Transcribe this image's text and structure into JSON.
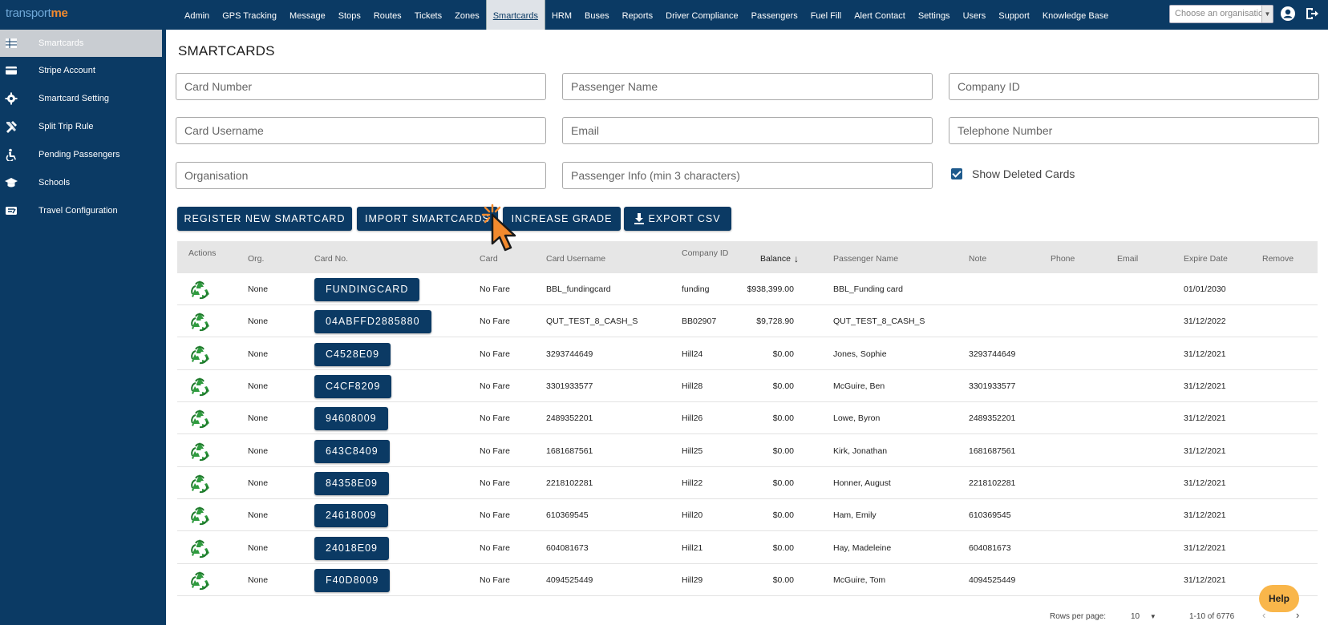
{
  "brand": {
    "part1": "transport",
    "part2": "me"
  },
  "nav": [
    "Admin",
    "GPS Tracking",
    "Message",
    "Stops",
    "Routes",
    "Tickets",
    "Zones",
    "Smartcards",
    "HRM",
    "Buses",
    "Reports",
    "Driver Compliance",
    "Passengers",
    "Fuel Fill",
    "Alert Contact",
    "Settings",
    "Users",
    "Support",
    "Knowledge Base"
  ],
  "nav_active": "Smartcards",
  "org_select": {
    "placeholder": "Choose an organisation"
  },
  "sidebar": [
    {
      "label": "Smartcards",
      "icon": "table-icon",
      "active": true
    },
    {
      "label": "Stripe Account",
      "icon": "credit-card-icon"
    },
    {
      "label": "Smartcard Setting",
      "icon": "gear-icon"
    },
    {
      "label": "Split Trip Rule",
      "icon": "tools-icon"
    },
    {
      "label": "Pending Passengers",
      "icon": "accessible-icon"
    },
    {
      "label": "Schools",
      "icon": "graduation-cap-icon"
    },
    {
      "label": "Travel Configuration",
      "icon": "config-card-icon"
    }
  ],
  "page_title": "SMARTCARDS",
  "filters": {
    "card_number": "Card Number",
    "passenger_name": "Passenger Name",
    "company_id": "Company ID",
    "card_username": "Card Username",
    "email": "Email",
    "telephone": "Telephone Number",
    "organisation": "Organisation",
    "passenger_info": "Passenger Info (min 3 characters)",
    "show_deleted": "Show Deleted Cards"
  },
  "buttons": {
    "register": "REGISTER NEW SMARTCARD",
    "import": "IMPORT SMARTCARDS",
    "increase": "INCREASE GRADE",
    "export": "EXPORT CSV"
  },
  "columns": [
    "Actions",
    "Org.",
    "Card No.",
    "Card",
    "Card Username",
    "Company ID",
    "Balance",
    "Passenger Name",
    "Note",
    "Phone",
    "Email",
    "Expire Date",
    "Remove"
  ],
  "rows": [
    {
      "org": "None",
      "card_no": "FUNDINGCARD",
      "fare": "No Fare",
      "username": "BBL_fundingcard",
      "company": "funding",
      "balance": "$938,399.00",
      "name": "BBL_Funding card",
      "note": "",
      "expire": "01/01/2030"
    },
    {
      "org": "None",
      "card_no": "04ABFFD2885880",
      "fare": "No Fare",
      "username": "QUT_TEST_8_CASH_S",
      "company": "BB02907",
      "balance": "$9,728.90",
      "name": "QUT_TEST_8_CASH_S",
      "note": "",
      "expire": "31/12/2022"
    },
    {
      "org": "None",
      "card_no": "C4528E09",
      "fare": "No Fare",
      "username": "3293744649",
      "company": "Hill24",
      "balance": "$0.00",
      "name": "Jones, Sophie",
      "note": "3293744649",
      "expire": "31/12/2021"
    },
    {
      "org": "None",
      "card_no": "C4CF8209",
      "fare": "No Fare",
      "username": "3301933577",
      "company": "Hill28",
      "balance": "$0.00",
      "name": "McGuire, Ben",
      "note": "3301933577",
      "expire": "31/12/2021"
    },
    {
      "org": "None",
      "card_no": "94608009",
      "fare": "No Fare",
      "username": "2489352201",
      "company": "Hill26",
      "balance": "$0.00",
      "name": "Lowe, Byron",
      "note": "2489352201",
      "expire": "31/12/2021"
    },
    {
      "org": "None",
      "card_no": "643C8409",
      "fare": "No Fare",
      "username": "1681687561",
      "company": "Hill25",
      "balance": "$0.00",
      "name": "Kirk, Jonathan",
      "note": "1681687561",
      "expire": "31/12/2021"
    },
    {
      "org": "None",
      "card_no": "84358E09",
      "fare": "No Fare",
      "username": "2218102281",
      "company": "Hill22",
      "balance": "$0.00",
      "name": "Honner, August",
      "note": "2218102281",
      "expire": "31/12/2021"
    },
    {
      "org": "None",
      "card_no": "24618009",
      "fare": "No Fare",
      "username": "610369545",
      "company": "Hill20",
      "balance": "$0.00",
      "name": "Ham, Emily",
      "note": "610369545",
      "expire": "31/12/2021"
    },
    {
      "org": "None",
      "card_no": "24018E09",
      "fare": "No Fare",
      "username": "604081673",
      "company": "Hill21",
      "balance": "$0.00",
      "name": "Hay, Madeleine",
      "note": "604081673",
      "expire": "31/12/2021"
    },
    {
      "org": "None",
      "card_no": "F40D8009",
      "fare": "No Fare",
      "username": "4094525449",
      "company": "Hill29",
      "balance": "$0.00",
      "name": "McGuire, Tom",
      "note": "4094525449",
      "expire": "31/12/2021"
    }
  ],
  "footer": {
    "rows_per_page_label": "Rows per page:",
    "rows_per_page": "10",
    "range": "1-10 of 6776"
  },
  "help": "Help",
  "colors": {
    "primary": "#0b3a64",
    "accent": "#f28a2e",
    "help": "#f9b64a"
  }
}
